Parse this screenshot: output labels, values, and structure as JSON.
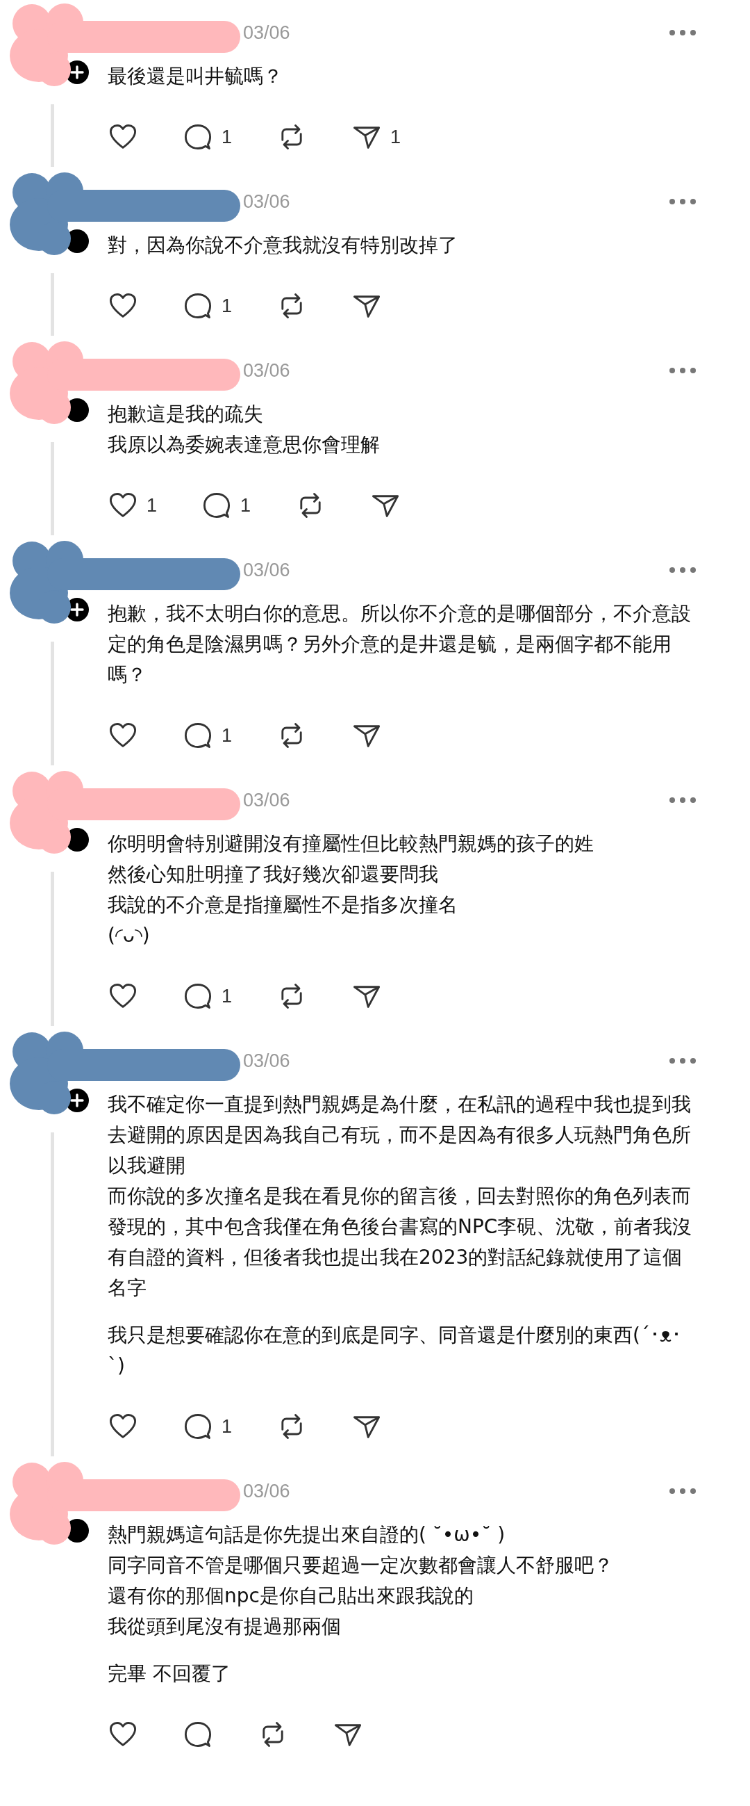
{
  "posts": [
    {
      "color": "#ffb8bb",
      "plus": true,
      "date": "03/06",
      "paragraphs": [
        [
          "最後還是叫井毓嗎？"
        ]
      ],
      "actions": {
        "replies": "1",
        "shares": "1"
      }
    },
    {
      "color": "#6189b3",
      "plus": false,
      "date": "03/06",
      "paragraphs": [
        [
          "對，因為你說不介意我就沒有特別改掉了"
        ]
      ],
      "actions": {
        "replies": "1"
      }
    },
    {
      "color": "#ffb8bb",
      "plus": false,
      "date": "03/06",
      "paragraphs": [
        [
          "抱歉這是我的疏失",
          "我原以為委婉表達意思你會理解"
        ]
      ],
      "actions": {
        "likes": "1",
        "replies": "1"
      }
    },
    {
      "color": "#6189b3",
      "plus": true,
      "date": "03/06",
      "paragraphs": [
        [
          "抱歉，我不太明白你的意思。所以你不介意的是哪個部分，不介意設定的角色是陰濕男嗎？另外介意的是井還是毓，是兩個字都不能用嗎？"
        ]
      ],
      "actions": {
        "replies": "1"
      }
    },
    {
      "color": "#ffb8bb",
      "plus": false,
      "date": "03/06",
      "paragraphs": [
        [
          "你明明會特別避開沒有撞屬性但比較熱門親媽的孩子的姓",
          "然後心知肚明撞了我好幾次卻還要問我",
          "我說的不介意是指撞屬性不是指多次撞名",
          "(◜ᴗ◝)"
        ]
      ],
      "actions": {
        "replies": "1"
      }
    },
    {
      "color": "#6189b3",
      "plus": true,
      "date": "03/06",
      "paragraphs": [
        [
          "我不確定你一直提到熱門親媽是為什麼，在私訊的過程中我也提到我去避開的原因是因為我自己有玩，而不是因為有很多人玩熱門角色所以我避開",
          "而你說的多次撞名是我在看見你的留言後，回去對照你的角色列表而發現的，其中包含我僅在角色後台書寫的NPC李硯、沈敬，前者我沒有自證的資料，但後者我也提出我在2023的對話紀錄就使用了這個名字"
        ],
        [
          "我只是想要確認你在意的到底是同字、同音還是什麼別的東西(´･ᴥ･ `)"
        ]
      ],
      "actions": {
        "replies": "1"
      }
    },
    {
      "color": "#ffb8bb",
      "plus": false,
      "date": "03/06",
      "paragraphs": [
        [
          "熱門親媽這句話是你先提出來自證的( ˘•ω•˘ )",
          "同字同音不管是哪個只要超過一定次數都會讓人不舒服吧？",
          "還有你的那個npc是你自己貼出來跟我說的",
          "我從頭到尾沒有提過那兩個"
        ],
        [
          "完畢 不回覆了"
        ]
      ]
    }
  ]
}
